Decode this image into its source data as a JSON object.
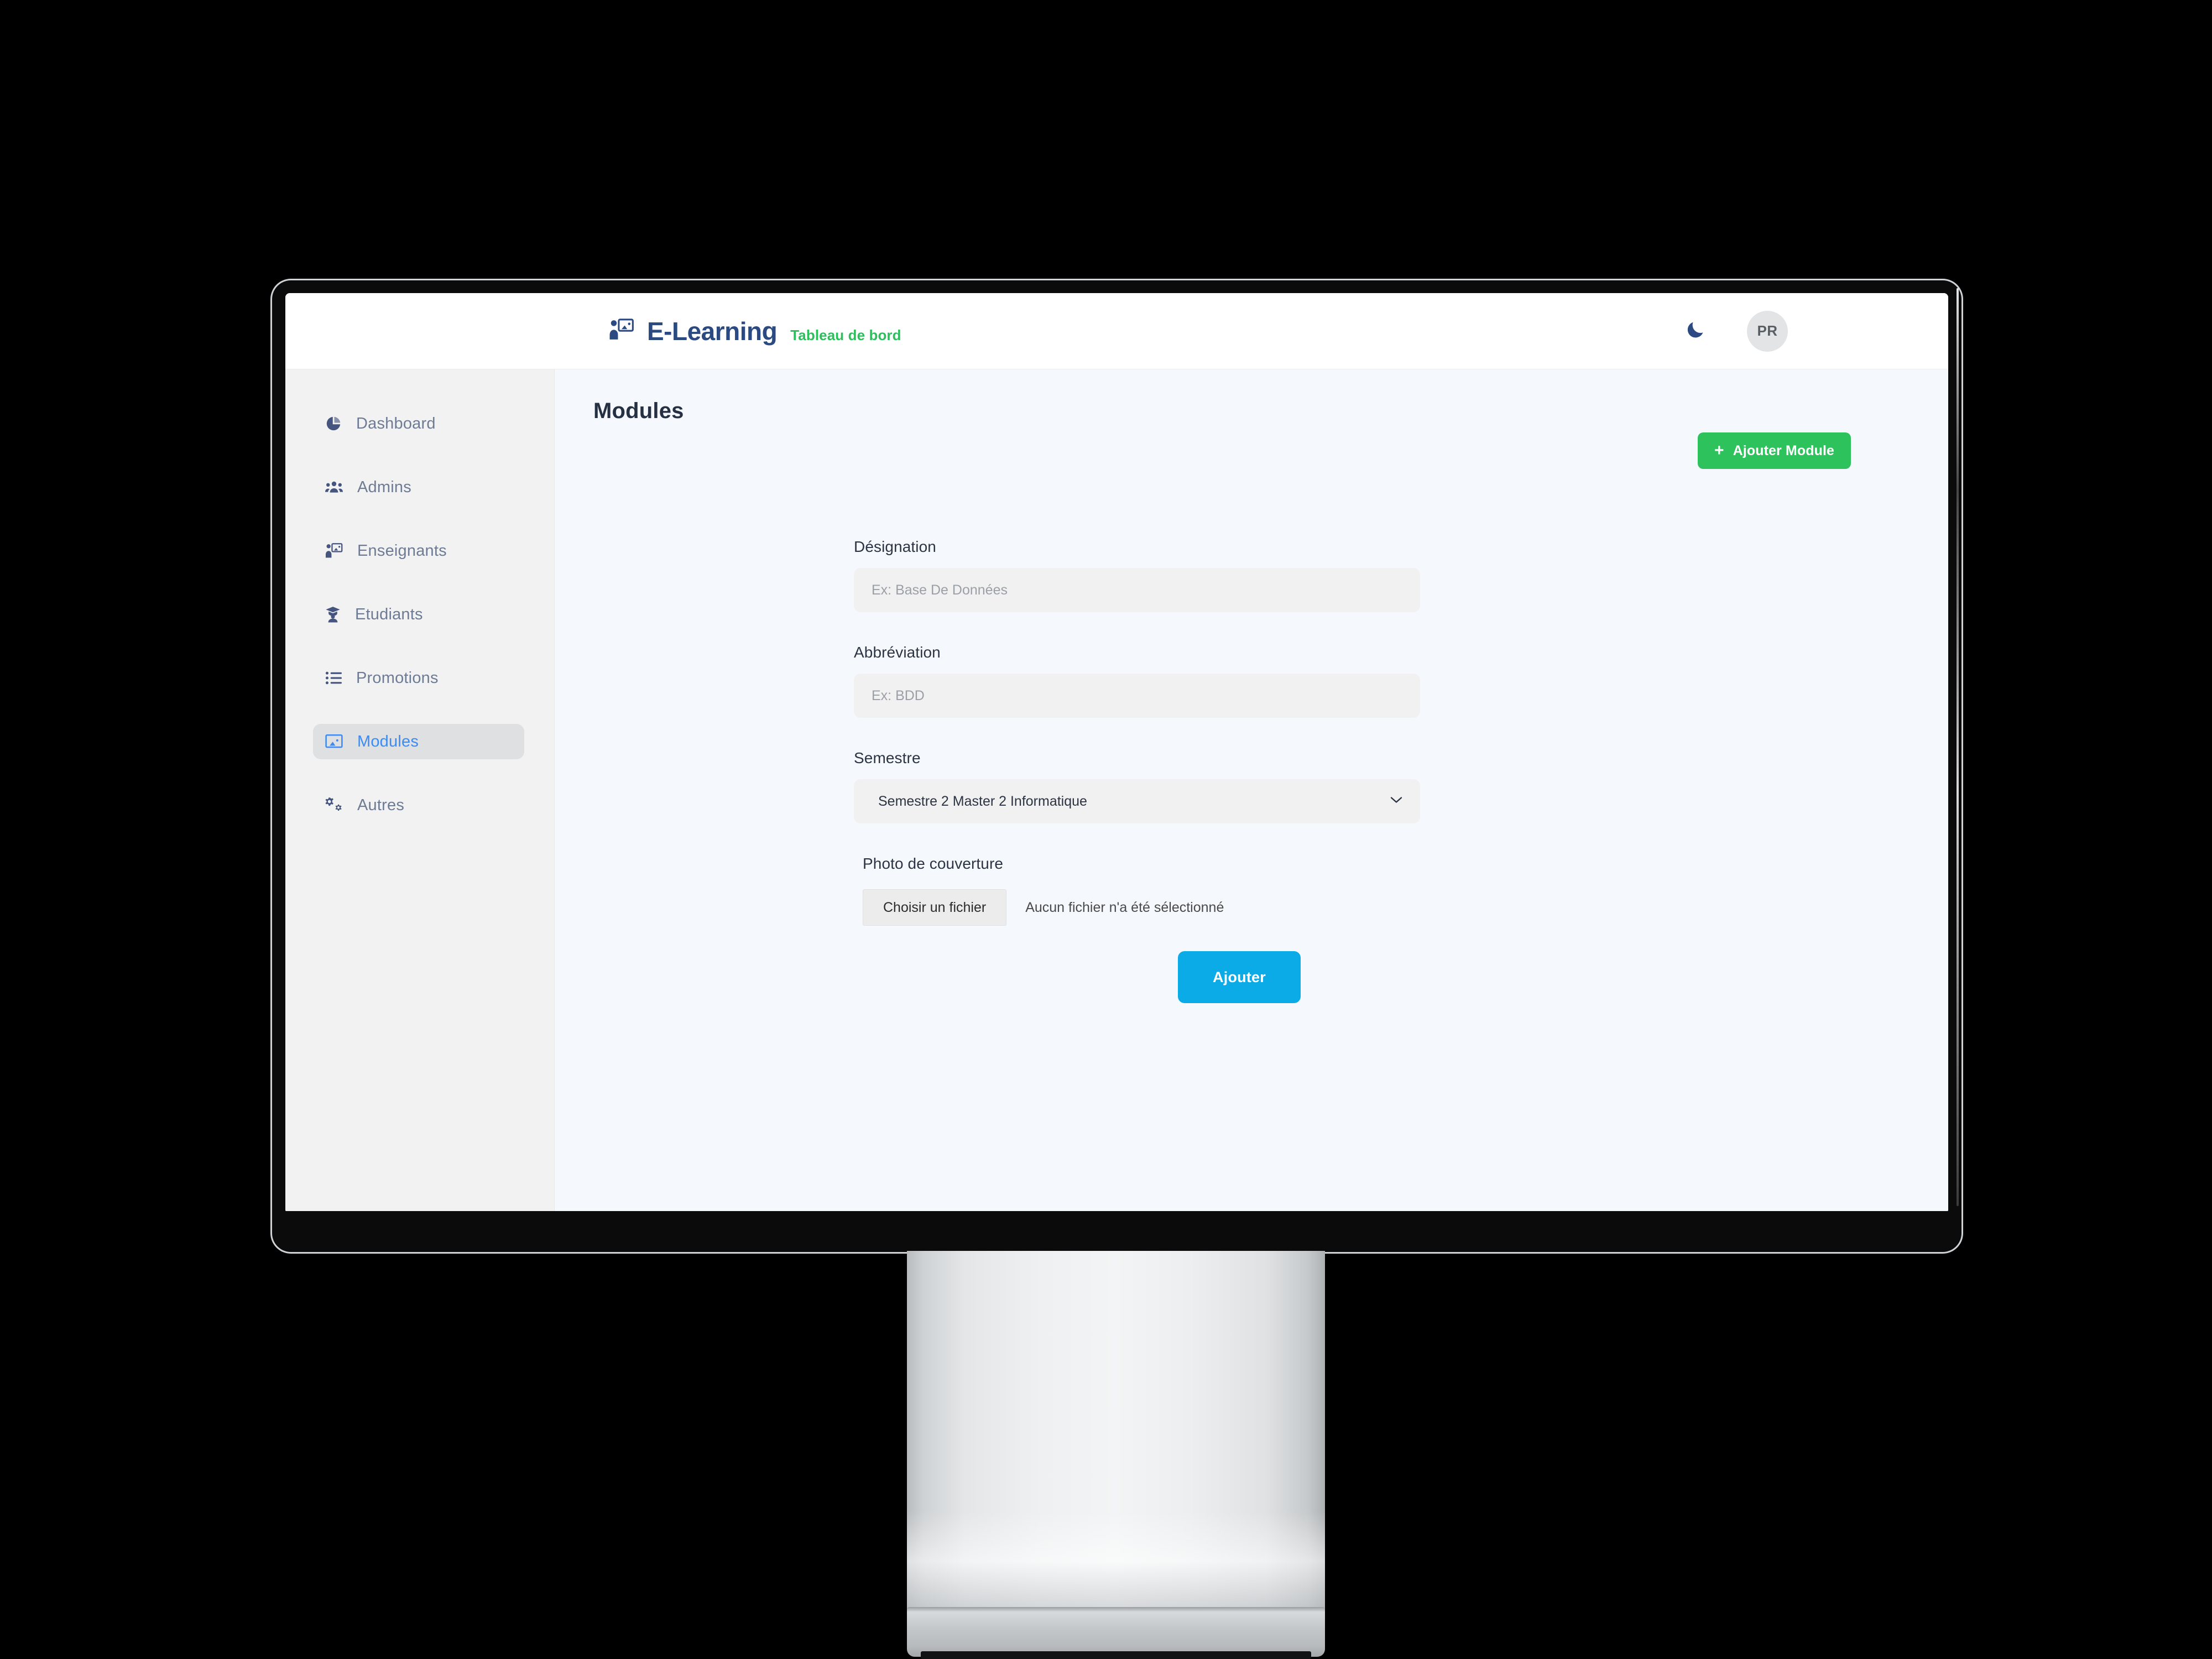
{
  "brand": {
    "icon": "chalkboard-teacher-icon",
    "name": "E-Learning",
    "subtitle": "Tableau de bord",
    "name_color": "#2b4a82",
    "subtitle_color": "#2cbf5c"
  },
  "header": {
    "theme_toggle_icon": "moon-icon",
    "avatar_initials": "PR"
  },
  "sidebar": {
    "items": [
      {
        "label": "Dashboard",
        "icon": "pie-chart-icon",
        "active": false
      },
      {
        "label": "Admins",
        "icon": "users-group-icon",
        "active": false
      },
      {
        "label": "Enseignants",
        "icon": "chalkboard-teacher-icon",
        "active": false
      },
      {
        "label": "Etudiants",
        "icon": "user-graduate-icon",
        "active": false
      },
      {
        "label": "Promotions",
        "icon": "list-ul-icon",
        "active": false
      },
      {
        "label": "Modules",
        "icon": "chalkboard-icon",
        "active": true
      },
      {
        "label": "Autres",
        "icon": "cogs-icon",
        "active": false
      }
    ],
    "active_text_color": "#3d8bf2",
    "active_bg_color": "#dfe0e1"
  },
  "main": {
    "page_title": "Modules",
    "add_button": {
      "label": "Ajouter Module",
      "icon": "plus-icon",
      "color": "#2ec25c"
    },
    "form": {
      "designation": {
        "label": "Désignation",
        "value": "",
        "placeholder": "Ex: Base De Données"
      },
      "abbreviation": {
        "label": "Abbréviation",
        "value": "",
        "placeholder": "Ex: BDD"
      },
      "semestre": {
        "label": "Semestre",
        "selected": "Semestre 2 Master 2 Informatique",
        "chevron_icon": "chevron-down-icon"
      },
      "photo": {
        "label": "Photo de couverture",
        "button_label": "Choisir un fichier",
        "status": "Aucun fichier n'a été sélectionné"
      },
      "submit": {
        "label": "Ajouter",
        "color": "#0aabe6"
      }
    }
  }
}
